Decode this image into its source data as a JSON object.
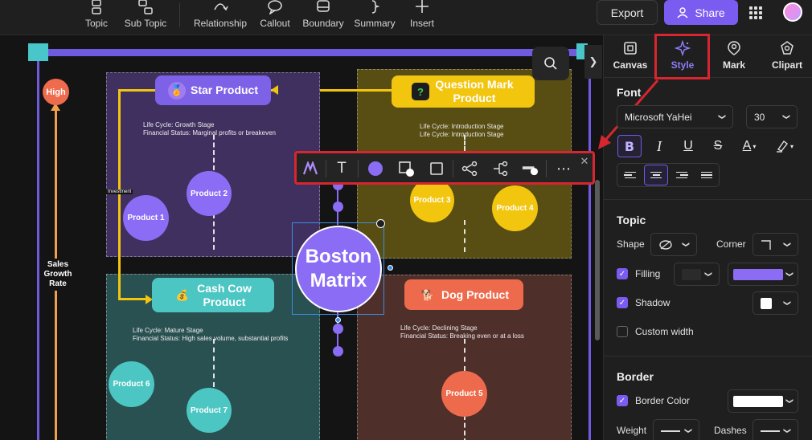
{
  "toolbar": {
    "items": [
      {
        "label": "Topic",
        "icon": "topic-icon"
      },
      {
        "label": "Sub Topic",
        "icon": "subtopic-icon"
      },
      {
        "label": "Relationship",
        "icon": "relationship-icon"
      },
      {
        "label": "Callout",
        "icon": "callout-icon"
      },
      {
        "label": "Boundary",
        "icon": "boundary-icon"
      },
      {
        "label": "Summary",
        "icon": "summary-icon"
      },
      {
        "label": "Insert",
        "icon": "plus-icon"
      }
    ],
    "export_label": "Export",
    "share_label": "Share"
  },
  "canvas": {
    "high_label": "High",
    "axis_label": "Sales Growth Rate",
    "investment_label": "Investment",
    "center_topic": "Boston Matrix",
    "quadrants": {
      "star": {
        "title": "Star Product",
        "desc1": "Life Cycle: Growth Stage",
        "desc2": "Financial Status: Marginal profits or breakeven",
        "color": "#7d62e8"
      },
      "question": {
        "title": "Question Mark Product",
        "desc1": "Life Cycle: Introduction Stage",
        "desc2": "Life Cycle: Introduction Stage",
        "color": "#f2c50f"
      },
      "cash": {
        "title": "Cash Cow Product",
        "desc1": "Life Cycle: Mature Stage",
        "desc2": "Financial Status: High sales volume, substantial profits",
        "color": "#4cc6c3"
      },
      "dog": {
        "title": "Dog Product",
        "desc1": "Life Cycle: Declining Stage",
        "desc2": "Financial Status: Breaking even or at a loss",
        "color": "#ee6a4c"
      }
    },
    "products": [
      "Product 1",
      "Product 2",
      "Product 3",
      "Product 4",
      "Product 5",
      "Product 6",
      "Product 7"
    ]
  },
  "floating_toolbar": {
    "icons": [
      "ai-style-icon",
      "text-icon",
      "fill-color-icon",
      "shape-icon",
      "border-icon",
      "layout-icon",
      "connector-icon",
      "line-style-icon",
      "more-icon",
      "close-icon"
    ]
  },
  "panel": {
    "tabs": [
      {
        "label": "Canvas",
        "icon": "canvas-icon"
      },
      {
        "label": "Style",
        "icon": "sparkle-icon",
        "active": true
      },
      {
        "label": "Mark",
        "icon": "mark-icon"
      },
      {
        "label": "Clipart",
        "icon": "clipart-icon"
      }
    ],
    "font": {
      "title": "Font",
      "family": "Microsoft YaHei",
      "size": "30"
    },
    "topic": {
      "title": "Topic",
      "shape_label": "Shape",
      "corner_label": "Corner",
      "filling_label": "Filling",
      "shadow_label": "Shadow",
      "custom_width_label": "Custom width",
      "fill_color": "#8c6cf4"
    },
    "border": {
      "title": "Border",
      "border_color_label": "Border Color",
      "weight_label": "Weight",
      "dashes_label": "Dashes"
    }
  }
}
